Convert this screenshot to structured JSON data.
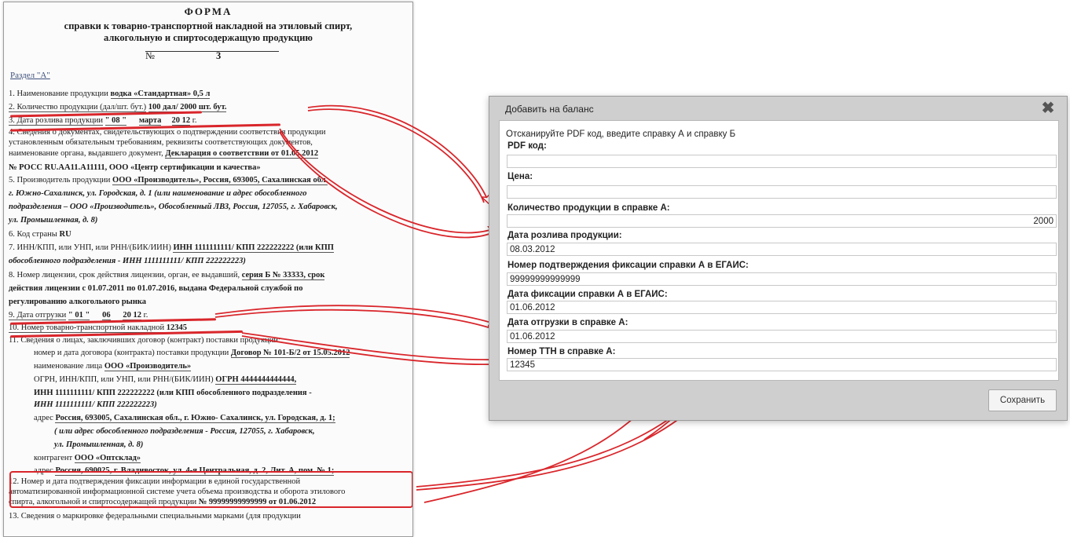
{
  "document": {
    "heading": "ФОРМА",
    "subtitle_line1": "справки к товарно-транспортной накладной на этиловый спирт,",
    "subtitle_line2": "алкогольную и спиртосодержащую продукцию",
    "number_label": "№",
    "number_value": "3",
    "section": "Раздел \"А\"",
    "l1_label": "1. Наименование продукции",
    "l1_value": "водка «Стандартная» 0,5 л",
    "l2_label": "2. Количество продукции (дал/шт. бут.)",
    "l2_value": "100 дал/ 2000 шт. бут.",
    "l3_label": "3. Дата розлива продукции",
    "l3_day": "\" 08 \"",
    "l3_month": "марта",
    "l3_year": "20 12",
    "l3_suffix": "г.",
    "l4_line1": "4. Сведения о документах, свидетельствующих о подтверждении соответствия продукции",
    "l4_line2": "установленным обязательным требованиям, реквизиты соответствующих документов,",
    "l4_line3_label": "наименование органа, выдавшего документ,",
    "l4_line3_value": "Декларация о соответствии от 01.05.2012",
    "l4_line4": "№ РОСС RU.AA11.A11111, ООО «Центр сертификации и качества»",
    "l5_label": "5. Производитель продукции",
    "l5_value": "ООО «Производитель», Россия, 693005, Сахалинская обл.",
    "l5_line2": "г. Южно-Сахалинск, ул. Городская, д. 1 (или наименование и адрес обособленного",
    "l5_line3": "подразделения – ООО «Производитель», Обособленный ЛВЗ, Россия, 127055, г. Хабаровск,",
    "l5_line4": "ул. Промышленная, д. 8)",
    "l6_label": "6. Код страны",
    "l6_value": "RU",
    "l7_label": "7. ИНН/КПП, или УНП, или РНН/(БИК/ИИН)",
    "l7_value": "ИНН 1111111111/ КПП 222222222 (или КПП",
    "l7_line2": "обособленного подразделения - ИНН 1111111111/ КПП 222222223)",
    "l8_label": "8. Номер лицензии, срок действия лицензии, орган, ее выдавший,",
    "l8_value": "серия Б № 33333, срок",
    "l8_line2": "действия лицензии с 01.07.2011 по 01.07.2016, выдана Федеральной службой по",
    "l8_line3": "регулированию алкогольного рынка",
    "l9_label": "9. Дата отгрузки",
    "l9_day": "\" 01 \"",
    "l9_month": "06",
    "l9_year": "20 12",
    "l9_suffix": "г.",
    "l10_label": "10. Номер товарно-транспортной накладной",
    "l10_value": "12345",
    "l11_label": "11. Сведения о лицах, заключивших договор (контракт) поставки продукции:",
    "l11_contract_label": "номер и дата договора (контракта) поставки продукции",
    "l11_contract_value": "Договор № 101-Б/2 от 15.05.2012",
    "l11_name_label": "наименование лица",
    "l11_name_value": "ООО «Производитель»",
    "l11_ogrn_label": "ОГРН, ИНН/КПП, или УНП, или РНН/(БИК/ИИН)",
    "l11_ogrn_value": "ОГРН 4444444444444,",
    "l11_inn_line": "ИНН 1111111111/ КПП 222222222 (или КПП обособленного подразделения -",
    "l11_inn_line2": "ИНН 1111111111/ КПП 222222223)",
    "l11_addr_label": "адрес",
    "l11_addr_value": "Россия, 693005, Сахалинская обл., г. Южно- Сахалинск, ул. Городская, д. 1;",
    "l11_addr_line2": "( или адрес обособленного подразделения - Россия, 127055, г. Хабаровск,",
    "l11_addr_line3": "ул. Промышленная, д. 8)",
    "l11_counter_label": "контрагент",
    "l11_counter_value": "ООО «Оптсклад»",
    "l11_caddr_label": "адрес",
    "l11_caddr_value": "Россия, 690025, г. Владивосток, ул. 4-я Центральная, д. 2, Лит. А, пом. № 1;",
    "l12_line1": "12. Номер и дата подтверждения фиксации информации в единой государственной",
    "l12_line2": "автоматизированной информационной системе учета объема производства и оборота этилового",
    "l12_line3_label": "спирта, алкогольной и спиртосодержащей продукции",
    "l12_line3_value": "№ 99999999999999 от 01.06.2012",
    "l13_partial": "13. Сведения о маркировке федеральными специальными марками (для продукции"
  },
  "dialog": {
    "title": "Добавить на баланс",
    "close_icon": "close-x-icon",
    "instruction": "Отсканируйте PDF код, введите справку А и справку Б",
    "fields": [
      {
        "label": "PDF код:",
        "value": ""
      },
      {
        "label": "Цена:",
        "value": ""
      },
      {
        "label": "Количество продукции в справке А:",
        "value": "2000"
      },
      {
        "label": "Дата розлива продукции:",
        "value": "08.03.2012"
      },
      {
        "label": "Номер подтверждения фиксации справки А в ЕГАИС:",
        "value": "99999999999999"
      },
      {
        "label": "Дата фиксации справки А в ЕГАИС:",
        "value": "01.06.2012"
      },
      {
        "label": "Дата отгрузки в справке А:",
        "value": "01.06.2012"
      },
      {
        "label": "Номер ТТН в справке А:",
        "value": "12345"
      }
    ],
    "save_label": "Сохранить"
  },
  "colors": {
    "annotation_red": "#d9262b",
    "dialog_frame": "#cfcfcf",
    "dialog_body": "#ffffff"
  }
}
